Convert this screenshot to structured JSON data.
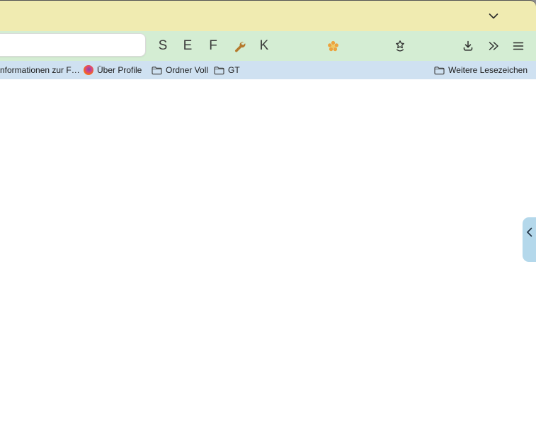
{
  "window": {
    "tab_bar": {
      "bg_color": "#f0ebb1",
      "tabs_dropdown_icon": "chevron-down"
    },
    "toolbar": {
      "bg_color": "#d4edd3",
      "address_value": "",
      "letters": [
        "S",
        "E",
        "F",
        "K"
      ],
      "icons": [
        "wrench-icon",
        "flower-icon",
        "star-tray-icon",
        "download-icon",
        "overflow-chevrons-icon",
        "menu-icon"
      ]
    },
    "bookmarks_bar": {
      "bg_color": "#cfe1f1",
      "items": [
        {
          "label": "nformationen zur F…",
          "icon": "none"
        },
        {
          "label": "Über Profile",
          "icon": "firefox-logo"
        },
        {
          "label": "Ordner Voll",
          "icon": "folder"
        },
        {
          "label": "GT",
          "icon": "folder"
        }
      ],
      "more_label": "Weitere Lesezeichen"
    },
    "side_panel_handle": {
      "bg_color": "#b4d8eb",
      "icon": "chevron-left"
    }
  },
  "colors": {
    "tab_bar_yellow": "#f0ebb1",
    "toolbar_green": "#d4edd3",
    "bookmarks_blue": "#cfe1f1",
    "handle_blue": "#b4d8eb",
    "top_border": "#545454",
    "desktop_gray": "#8d8d8d",
    "icon_dark": "#2b2b2b",
    "wrench_orange": "#b5792c",
    "flower_orange": "#eda33c"
  }
}
